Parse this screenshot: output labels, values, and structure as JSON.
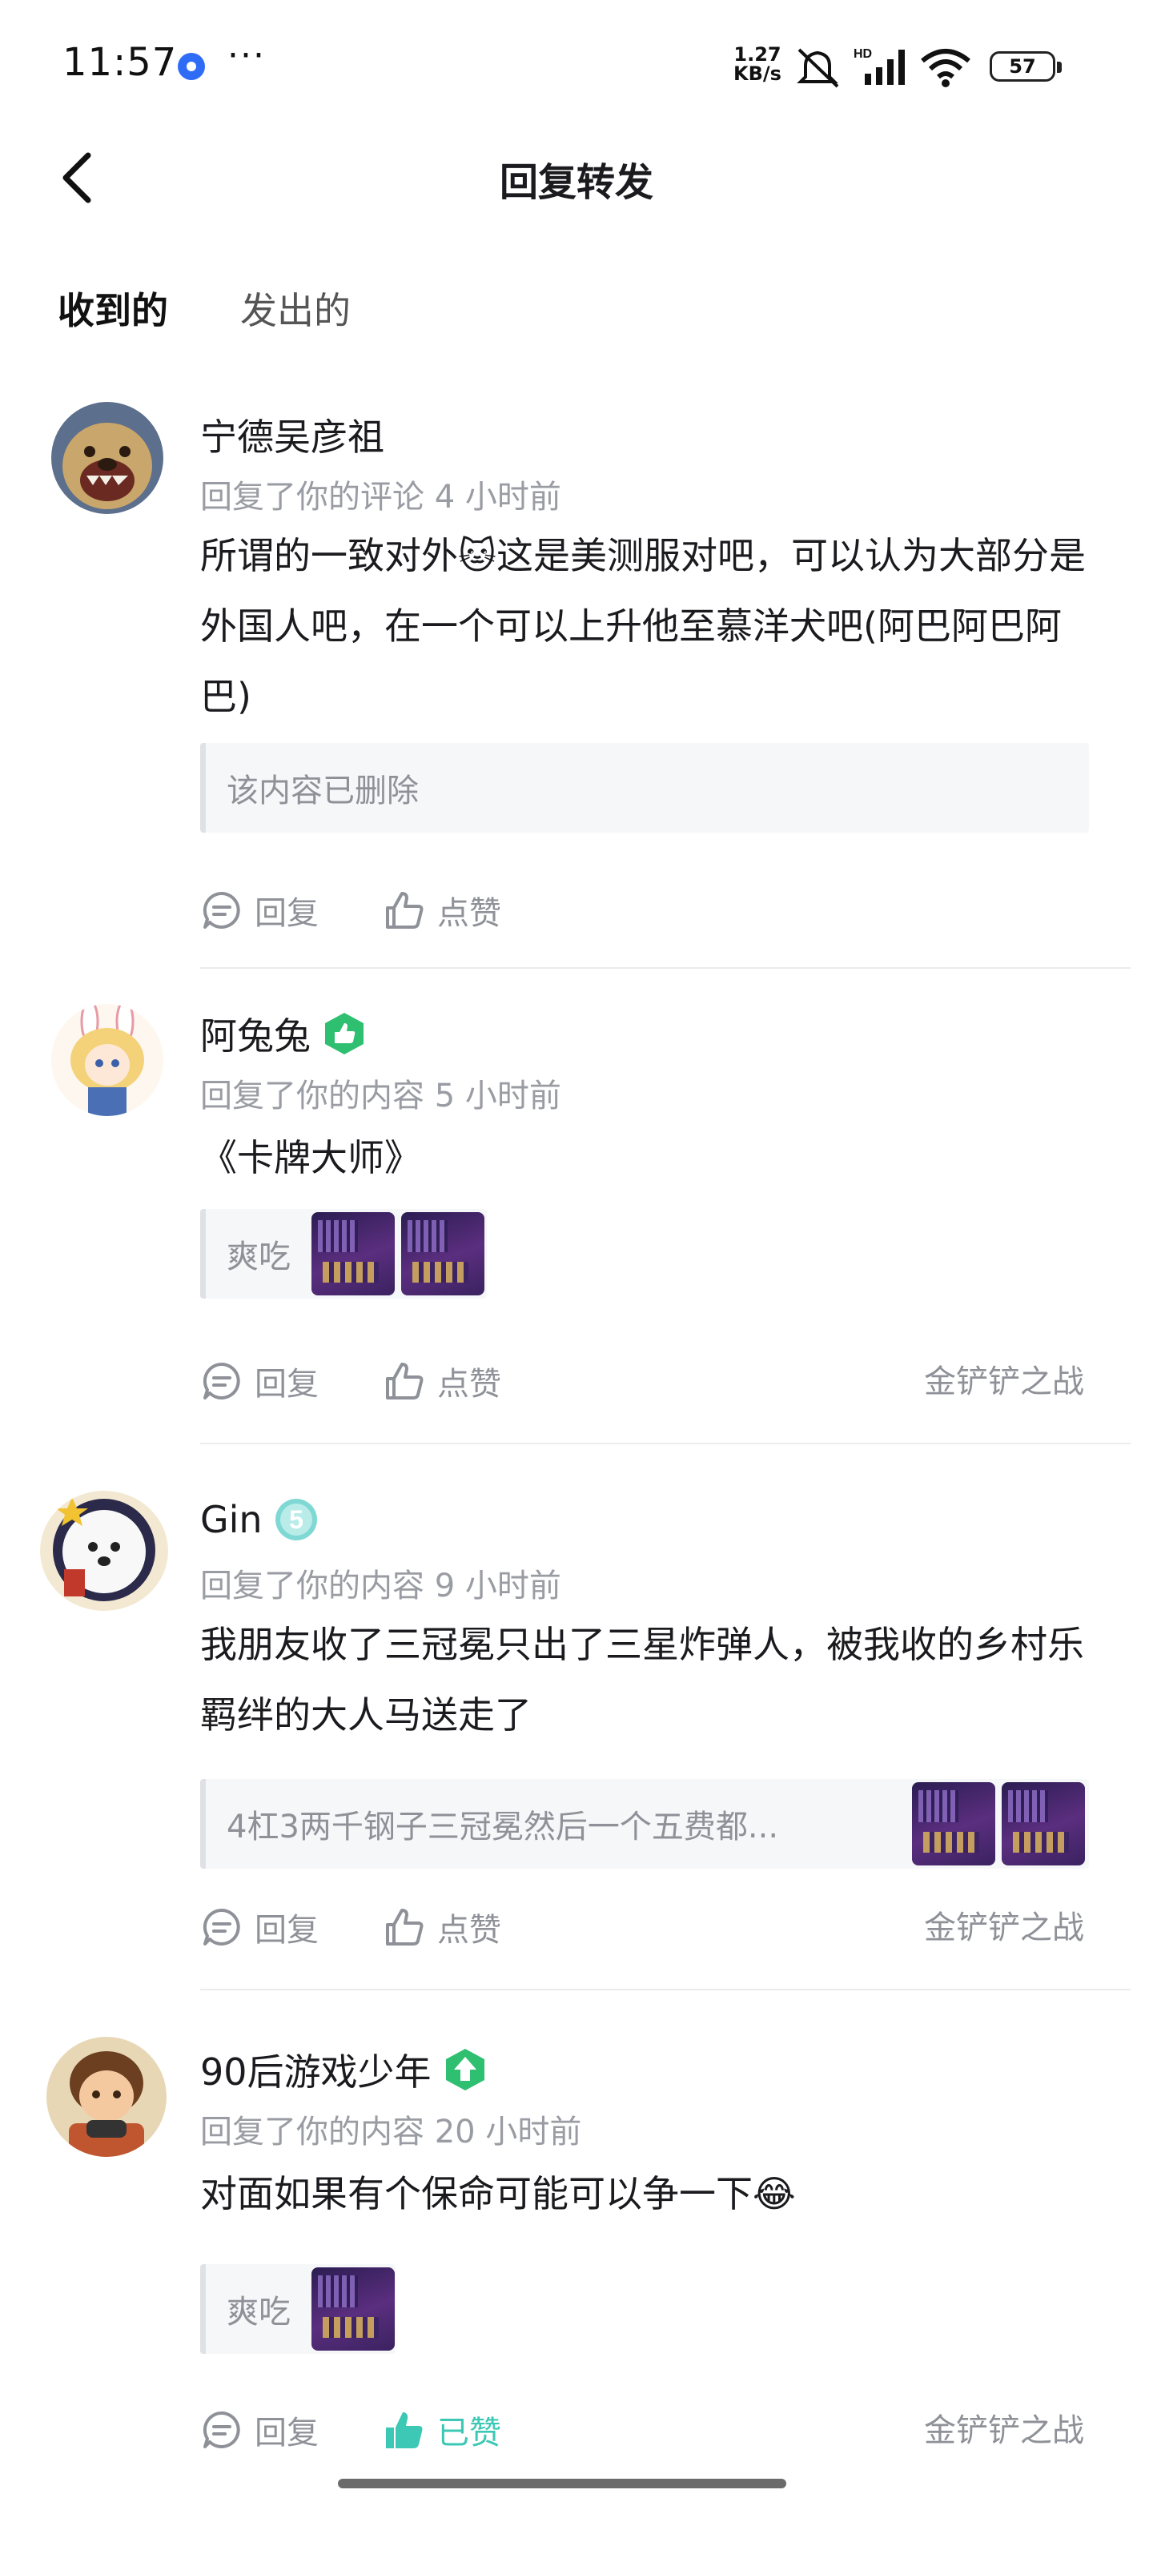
{
  "status_bar": {
    "time": "11:57",
    "more_dots": "···",
    "network_speed": "1.27 KB/s",
    "battery": "57",
    "icons": [
      "app-notification-icon",
      "mute-icon",
      "hd-signal-icon",
      "wifi-icon",
      "battery-icon"
    ]
  },
  "header": {
    "title": "回复转发",
    "back_icon": "chevron-left-icon"
  },
  "tabs": [
    {
      "label": "收到的",
      "active": true
    },
    {
      "label": "发出的",
      "active": false
    }
  ],
  "colors": {
    "accent": "#3cc8b4",
    "tab_underline": "#52d6bf",
    "secondary_text": "#8f9198",
    "badge_green": "#2fbf71"
  },
  "items": [
    {
      "username": "宁德吴彦祖",
      "meta": "回复了你的评论 4 小时前",
      "text": "所谓的一致对外🐱这是美测服对吧，可以认为大部分是外国人吧，在一个可以上升他至慕洋犬吧(阿巴阿巴阿巴)",
      "quote": "该内容已删除",
      "reply_label": "回复",
      "like_label": "点赞",
      "topic": ""
    },
    {
      "username": "阿兔兔",
      "meta": "回复了你的内容 5 小时前",
      "text": "《卡牌大师》",
      "quote": "爽吃",
      "reply_label": "回复",
      "like_label": "点赞",
      "topic": "金铲铲之战"
    },
    {
      "username": "Gin",
      "meta": "回复了你的内容 9 小时前",
      "text": "我朋友收了三冠冕只出了三星炸弹人，被我收的乡村乐羁绊的大人马送走了",
      "quote": "4杠3两千钢子三冠冕然后一个五费都...",
      "reply_label": "回复",
      "like_label": "点赞",
      "topic": "金铲铲之战"
    },
    {
      "username": "90后游戏少年",
      "meta": "回复了你的内容 20 小时前",
      "text": "对面如果有个保命可能可以争一下😂",
      "quote": "爽吃",
      "reply_label": "回复",
      "like_label": "已赞",
      "topic": "金铲铲之战"
    }
  ]
}
